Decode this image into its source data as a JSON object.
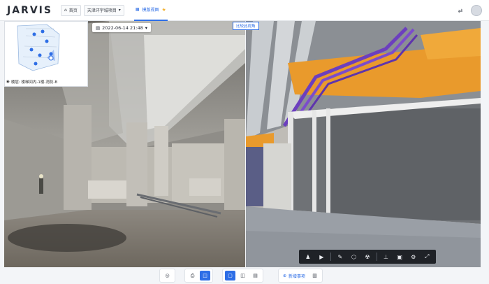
{
  "header": {
    "logo": "JARVIS",
    "home_label": "首页",
    "project_label": "天津环宇城项目",
    "view_tab_label": "模版视图",
    "icons": [
      "home-icon",
      "caret-down-icon",
      "grid-icon",
      "star-icon",
      "transfer-icon",
      "avatar"
    ]
  },
  "left_view": {
    "date": "2022-06-14 21:48",
    "minimap_caption": "楼层: 楼梯间内-1楼-消防-B"
  },
  "right_view": {
    "compare_label": "比较此视角"
  },
  "model_toolbar": {
    "icons": [
      "person-icon",
      "video-icon",
      "pen-icon",
      "cube-plus-icon",
      "radiation-icon",
      "hierarchy-icon",
      "layer-icon",
      "settings-icon",
      "expand-icon"
    ]
  },
  "dock": {
    "groups": [
      {
        "icons": [
          "eye-off-icon"
        ]
      },
      {
        "icons": [
          "camera-icon",
          "panorama-icon"
        ],
        "active": 1
      },
      {
        "icons": [
          "single-view-icon",
          "split-view-icon",
          "compare-icon"
        ],
        "active": 0
      },
      {
        "icons": [
          "issue-icon",
          "doc-icon"
        ]
      }
    ],
    "issue_label": "新增事项"
  },
  "colors": {
    "accent": "#2e6ee6",
    "duct_orange": "#e99a2c",
    "pipe_purple": "#6c3fbe"
  }
}
